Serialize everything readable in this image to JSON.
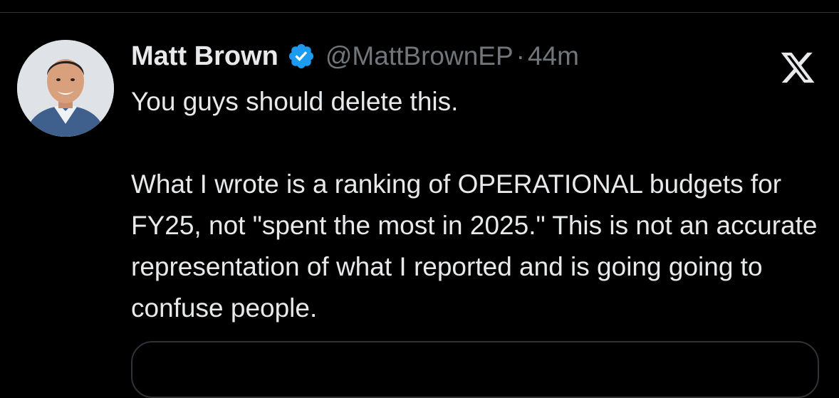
{
  "tweet": {
    "display_name": "Matt Brown",
    "handle": "@MattBrownEP",
    "separator": "·",
    "time": "44m",
    "verified": true,
    "verified_color": "#1d9bf0",
    "paragraph1": "You guys should delete this.",
    "paragraph2": "What I wrote is a ranking of OPERATIONAL budgets for FY25, not \"spent the most in 2025.\" This is not an accurate representation of what I reported and is going going to confuse people."
  },
  "icons": {
    "avatar": "avatar",
    "verified": "verified-badge-icon",
    "close": "x-logo-icon"
  },
  "colors": {
    "background": "#000000",
    "text": "#e7e9ea",
    "secondary": "#71767b",
    "border": "#2f3336",
    "accent": "#1d9bf0"
  }
}
